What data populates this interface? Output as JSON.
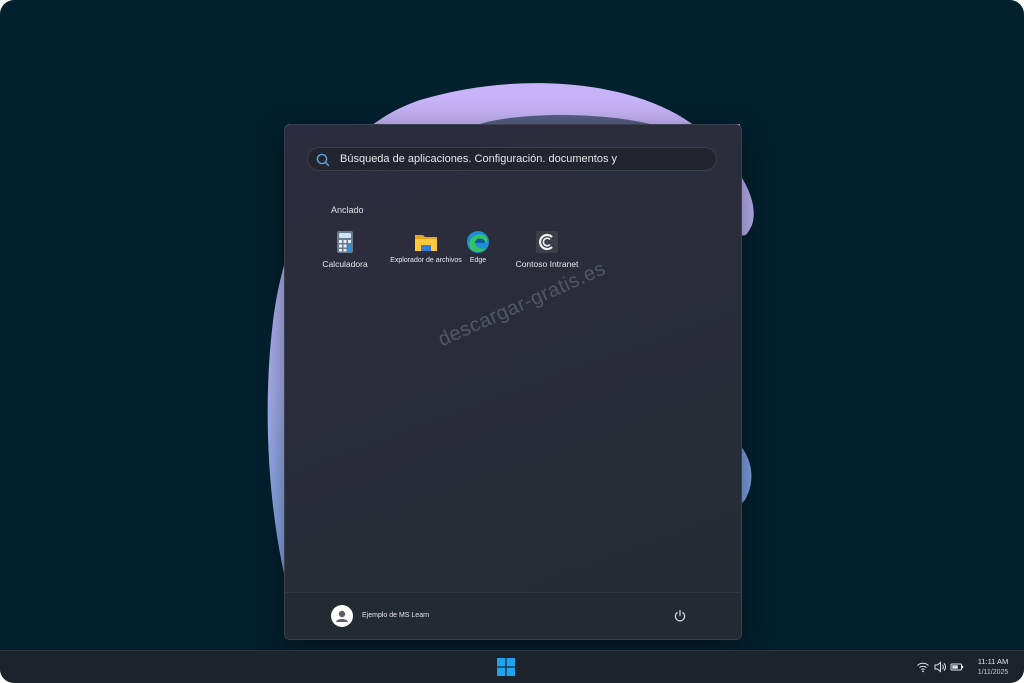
{
  "search": {
    "text": "Búsqueda de aplicaciones. Configuración. documentos y"
  },
  "pinned": {
    "title": "Anclado",
    "apps": [
      {
        "label": "Calculadora",
        "icon": "calculator-icon"
      },
      {
        "label": "Explorador de archivos",
        "icon": "folder-icon"
      },
      {
        "label": "Edge",
        "icon": "edge-icon"
      },
      {
        "label": "Contoso Intranet",
        "icon": "contoso-icon"
      }
    ]
  },
  "watermark": "descargar-gratis.es",
  "user": {
    "name": "Ejemplo de MS Learn"
  },
  "taskbar": {
    "time": "11:11 AM",
    "date": "1/11/2025"
  },
  "colors": {
    "desktop_bg": "#03202f",
    "accent_purple": "#c7b2f7",
    "accent_blue": "#7fa4e8",
    "windows_blue": "#1fa3ee"
  }
}
